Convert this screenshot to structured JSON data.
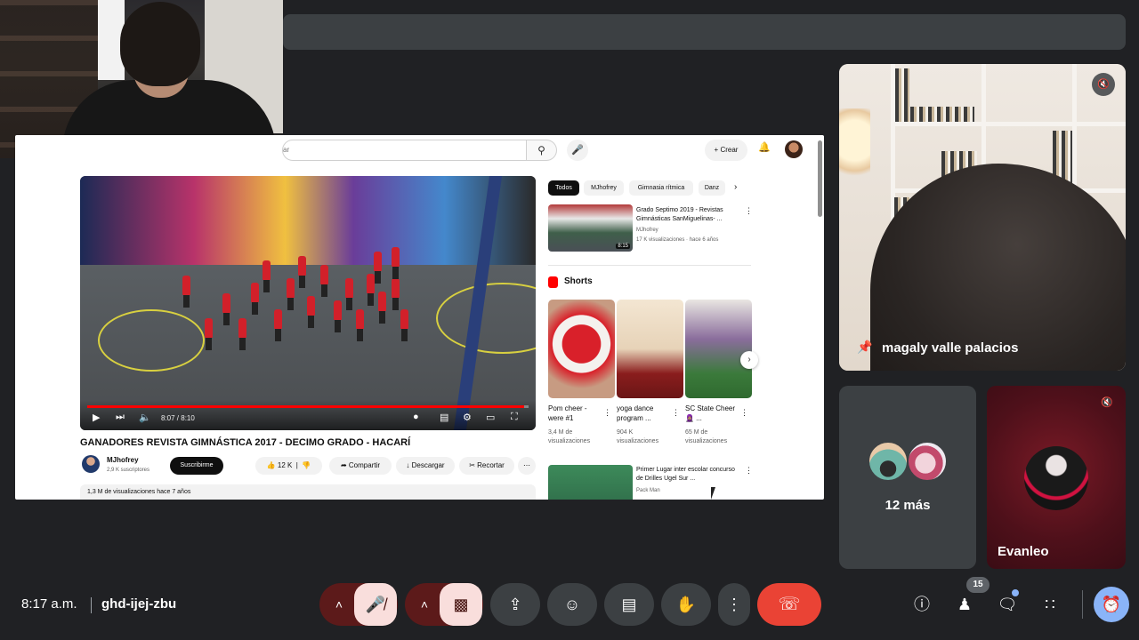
{
  "meeting": {
    "time": "8:17 a.m.",
    "code": "ghd-ijej-zbu",
    "people_count": "15"
  },
  "shared_screen": {
    "search_fragment": "ar",
    "create_label": "Crear",
    "video": {
      "title": "GANADORES REVISTA GIMNÁSTICA 2017 - DECIMO GRADO - HACARÍ",
      "time": "8:07 / 8:10",
      "progress": 0.99,
      "channel": "MJhofrey",
      "subscribers": "2,9 K suscriptores",
      "subscribe_label": "Suscribirme",
      "likes": "12 K",
      "share_label": "Compartir",
      "download_label": "Descargar",
      "clip_label": "Recortar",
      "description": "1,3 M de visualizaciones  hace 7 años"
    },
    "chips": [
      "Todos",
      "MJhofrey",
      "Gimnasia rítmica",
      "Danz"
    ],
    "recommended": [
      {
        "title": "Grado Septimo 2019 - Revistas Gimnásticas SanMiguelinas- ...",
        "channel": "MJhofrey",
        "meta": "17 K visualizaciones · hace 6 años",
        "duration": "8:15"
      },
      {
        "title": "Primer Lugar inter escolar concurso de Drilles Ugel Sur ...",
        "channel": "Pack Man",
        "meta": "",
        "duration": ""
      }
    ],
    "shorts_label": "Shorts",
    "shorts": [
      {
        "title": "Pom cheer - were #1",
        "views": "3,4 M de visualizaciones"
      },
      {
        "title": "yoga dance program ...",
        "views": "904 K visualizaciones"
      },
      {
        "title": "SC State Cheer 🧕🏽 ...",
        "views": "65 M de visualizaciones"
      }
    ]
  },
  "participants": {
    "pinned_name": "magaly valle palacios",
    "more_label": "12 más",
    "other_name": "Evanleo"
  },
  "colors": {
    "background": "#202124",
    "end_call": "#ea4335",
    "accent": "#8ab4f8",
    "muted_tile": "#5c1a1a"
  }
}
